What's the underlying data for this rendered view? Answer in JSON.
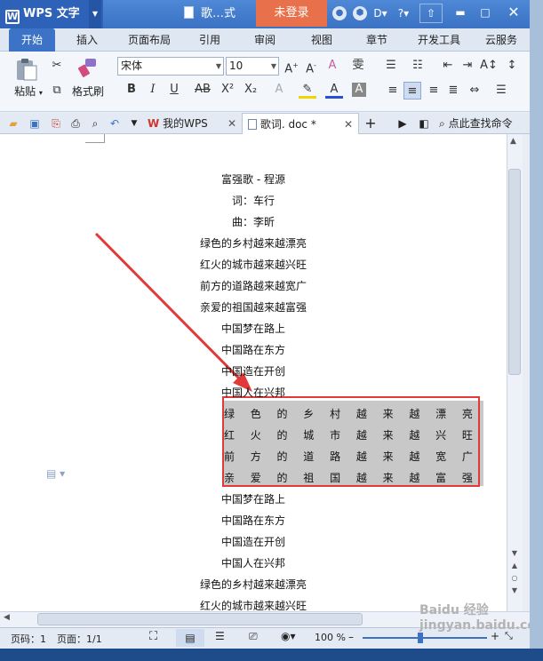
{
  "titlebar": {
    "app_name": "WPS 文字",
    "logo_letter": "W",
    "doc_title": "歌…式",
    "login": "未登录"
  },
  "menu": [
    {
      "label": "开始",
      "active": true
    },
    {
      "label": "插入"
    },
    {
      "label": "页面布局"
    },
    {
      "label": "引用"
    },
    {
      "label": "审阅"
    },
    {
      "label": "视图"
    },
    {
      "label": "章节"
    },
    {
      "label": "开发工具"
    },
    {
      "label": "云服务"
    }
  ],
  "ribbon": {
    "paste": "粘贴",
    "format_painter": "格式刷",
    "font_name": "宋体",
    "font_size": "10"
  },
  "tabs": {
    "my_wps": "我的WPS",
    "doc_tab": "歌词. doc *",
    "search_cmd": "点此查找命令"
  },
  "document": {
    "lines_top": [
      "富强歌 - 程源",
      "词：车行",
      "曲：李昕",
      "绿色的乡村越来越漂亮",
      "红火的城市越来越兴旺",
      "前方的道路越来越宽广",
      "亲爱的祖国越来越富强",
      "中国梦在路上",
      "中国路在东方",
      "中国造在开创",
      "中国人在兴邦"
    ],
    "spaced_lines": [
      [
        "绿",
        "色",
        "的",
        "乡",
        "村",
        "越",
        "来",
        "越",
        "漂",
        "亮"
      ],
      [
        "红",
        "火",
        "的",
        "城",
        "市",
        "越",
        "来",
        "越",
        "兴",
        "旺"
      ],
      [
        "前",
        "方",
        "的",
        "道",
        "路",
        "越",
        "来",
        "越",
        "宽",
        "广"
      ],
      [
        "亲",
        "爱",
        "的",
        "祖",
        "国",
        "越",
        "来",
        "越",
        "富",
        "强"
      ]
    ],
    "lines_bottom": [
      "中国梦在路上",
      "中国路在东方",
      "中国造在开创",
      "中国人在兴邦",
      "绿色的乡村越来越漂亮",
      "红火的城市越来越兴旺"
    ]
  },
  "statusbar": {
    "page": "页码：1",
    "pages": "页面：1/1",
    "zoom": "100 %"
  },
  "watermark": "Baidu 经验 jingyan.baidu.com",
  "colors": {
    "accent": "#3d73c6",
    "login": "#e8704a",
    "highlight_box": "#e23a3a",
    "arrow": "#e23a3a"
  }
}
